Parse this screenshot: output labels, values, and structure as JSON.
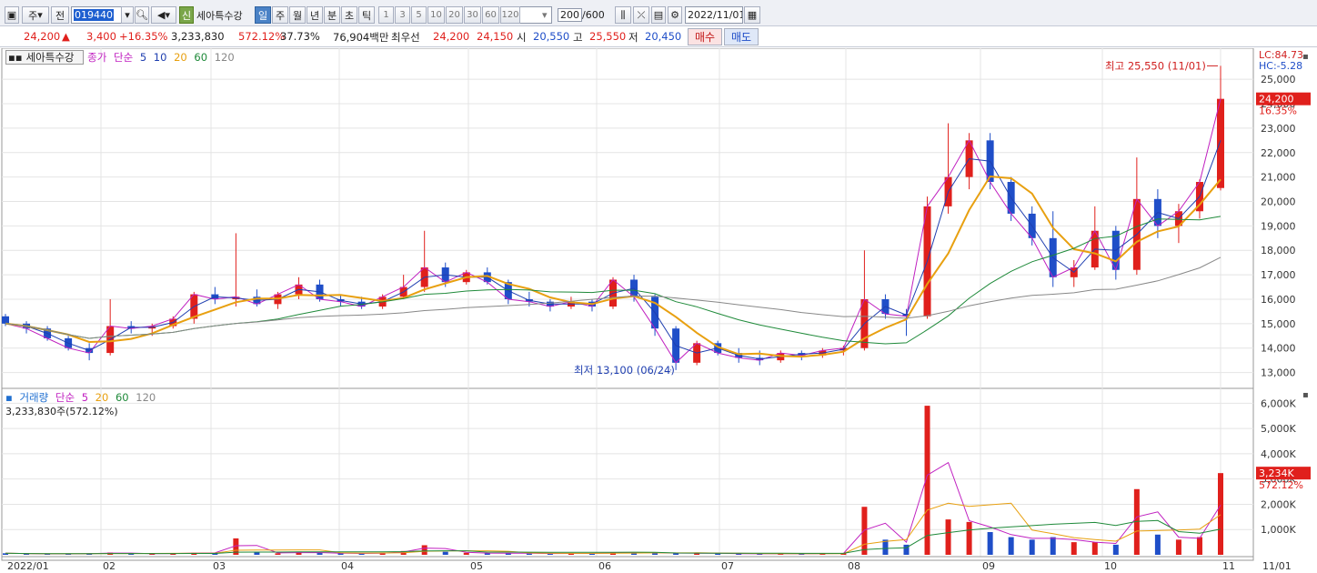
{
  "toolbar": {
    "mode1": "주",
    "mode2": "전",
    "code": "019440",
    "stock_tag": "신",
    "stock_name": "세아특수강",
    "periods": [
      "일",
      "주",
      "월",
      "년",
      "분",
      "초",
      "틱"
    ],
    "active_period": "일",
    "minutes": [
      "1",
      "3",
      "5",
      "10",
      "20",
      "30",
      "60",
      "120"
    ],
    "count": "200",
    "count_max": "/600",
    "date": "2022/11/01"
  },
  "quote": {
    "price": "24,200",
    "arrow": "▲",
    "change": "3,400",
    "change_pct": "+16.35%",
    "volume": "3,233,830",
    "volume_ratio": "572.12%",
    "turnover": "37.73%",
    "amount": "76,904백만",
    "best_label": "최우선",
    "ask": "24,200",
    "bid": "24,150",
    "open_label": "시",
    "open": "20,550",
    "high_label": "고",
    "high": "25,550",
    "low_label": "저",
    "low": "20,450",
    "buy_label": "매수",
    "sell_label": "매도"
  },
  "colors": {
    "up": "#e0201c",
    "down": "#1f4ec8",
    "ma5": "#1f3fb0",
    "ma10": "#c020c0",
    "ma20": "#e8a010",
    "ma60": "#1f8a3a",
    "ma120": "#888888"
  },
  "price_panel": {
    "title": "세아특수강",
    "legend": {
      "close_label": "종가",
      "simple_label": "단순",
      "ma5": "5",
      "ma10": "10",
      "ma20": "20",
      "ma60": "60",
      "ma120": "120"
    },
    "lc": "LC:84.73",
    "hc": "HC:-5.28",
    "current_tag": "24,200",
    "current_pct": "16.35%",
    "high_note": "최고 25,550 (11/01)",
    "low_note": "최저 13,100 (06/24)"
  },
  "volume_panel": {
    "legend": {
      "label": "거래량",
      "simple_label": "단순",
      "ma5": "5",
      "ma20": "20",
      "ma60": "60",
      "ma120": "120"
    },
    "current": "3,233,830주(572.12%)",
    "current_tag": "3,234K",
    "current_pct": "572.12%"
  },
  "chart_data": {
    "type": "candlestick",
    "x_labels": [
      "2022/01",
      "02",
      "03",
      "04",
      "05",
      "06",
      "07",
      "08",
      "09",
      "10",
      "11",
      "11/01"
    ],
    "price_ticks": [
      "25,000",
      "24,000",
      "23,000",
      "22,000",
      "21,000",
      "20,000",
      "19,000",
      "18,000",
      "17,000",
      "16,000",
      "15,000",
      "14,000",
      "13,000"
    ],
    "price_ylim": [
      12500,
      25900
    ],
    "volume_ticks": [
      "6,000K",
      "5,000K",
      "4,000K",
      "3,000K",
      "2,000K",
      "1,000K"
    ],
    "volume_ylim": [
      0,
      6300
    ],
    "ohlc_weekly_approx": [
      [
        15300,
        15400,
        14900,
        15000
      ],
      [
        15000,
        15100,
        14600,
        14800
      ],
      [
        14800,
        14900,
        14300,
        14400
      ],
      [
        14400,
        14500,
        13900,
        14000
      ],
      [
        14000,
        14200,
        13500,
        13800
      ],
      [
        13800,
        16000,
        13700,
        14900
      ],
      [
        14900,
        15100,
        14600,
        14800
      ],
      [
        14800,
        15000,
        14500,
        14900
      ],
      [
        14900,
        15300,
        14800,
        15200
      ],
      [
        15200,
        16300,
        15000,
        16200
      ],
      [
        16200,
        16500,
        15800,
        16000
      ],
      [
        16000,
        18700,
        15700,
        16100
      ],
      [
        16100,
        16400,
        15700,
        15800
      ],
      [
        15800,
        16300,
        15600,
        16200
      ],
      [
        16200,
        16900,
        16000,
        16600
      ],
      [
        16600,
        16800,
        15900,
        16000
      ],
      [
        16000,
        16200,
        15700,
        15900
      ],
      [
        15900,
        16100,
        15600,
        15700
      ],
      [
        15700,
        16200,
        15600,
        16100
      ],
      [
        16100,
        17000,
        16000,
        16500
      ],
      [
        16500,
        18800,
        16300,
        17300
      ],
      [
        17300,
        17500,
        16500,
        16700
      ],
      [
        16700,
        17200,
        16600,
        17100
      ],
      [
        17100,
        17300,
        16600,
        16700
      ],
      [
        16700,
        16800,
        15800,
        16000
      ],
      [
        16000,
        16300,
        15700,
        15900
      ],
      [
        15900,
        16000,
        15500,
        15700
      ],
      [
        15700,
        16100,
        15600,
        15900
      ],
      [
        15900,
        16000,
        15500,
        15700
      ],
      [
        15700,
        16900,
        15600,
        16800
      ],
      [
        16800,
        17000,
        15900,
        16100
      ],
      [
        16100,
        16200,
        14500,
        14800
      ],
      [
        14800,
        14900,
        13100,
        13400
      ],
      [
        13400,
        14300,
        13300,
        14200
      ],
      [
        14200,
        14300,
        13700,
        13800
      ],
      [
        13800,
        14000,
        13400,
        13600
      ],
      [
        13600,
        13900,
        13300,
        13500
      ],
      [
        13500,
        13900,
        13400,
        13800
      ],
      [
        13800,
        13900,
        13500,
        13700
      ],
      [
        13700,
        14000,
        13600,
        13900
      ],
      [
        13900,
        14100,
        13700,
        14000
      ],
      [
        14000,
        18000,
        13900,
        16000
      ],
      [
        16000,
        16200,
        15200,
        15400
      ],
      [
        15400,
        15600,
        14500,
        15300
      ],
      [
        15300,
        20200,
        15200,
        19800
      ],
      [
        19800,
        23200,
        19500,
        21000
      ],
      [
        21000,
        22800,
        20500,
        22500
      ],
      [
        22500,
        22800,
        20500,
        20800
      ],
      [
        20800,
        21000,
        19200,
        19500
      ],
      [
        19500,
        19800,
        18200,
        18500
      ],
      [
        18500,
        19600,
        16500,
        16900
      ],
      [
        16900,
        17600,
        16500,
        17300
      ],
      [
        17300,
        19800,
        17200,
        18800
      ],
      [
        18800,
        19000,
        16800,
        17200
      ],
      [
        17200,
        21800,
        17000,
        20100
      ],
      [
        20100,
        20500,
        18500,
        19000
      ],
      [
        19000,
        19900,
        18300,
        19600
      ],
      [
        19600,
        20900,
        19300,
        20800
      ],
      [
        20550,
        25550,
        20450,
        24200
      ]
    ],
    "volume_weekly_approx": [
      60,
      40,
      30,
      40,
      50,
      90,
      50,
      40,
      60,
      80,
      70,
      650,
      90,
      60,
      110,
      70,
      60,
      50,
      70,
      150,
      380,
      120,
      80,
      60,
      70,
      50,
      50,
      60,
      50,
      90,
      90,
      80,
      60,
      70,
      50,
      40,
      40,
      40,
      40,
      50,
      60,
      1900,
      600,
      400,
      5900,
      1400,
      1300,
      900,
      700,
      600,
      700,
      500,
      500,
      400,
      2600,
      800,
      600,
      700,
      3234
    ]
  }
}
